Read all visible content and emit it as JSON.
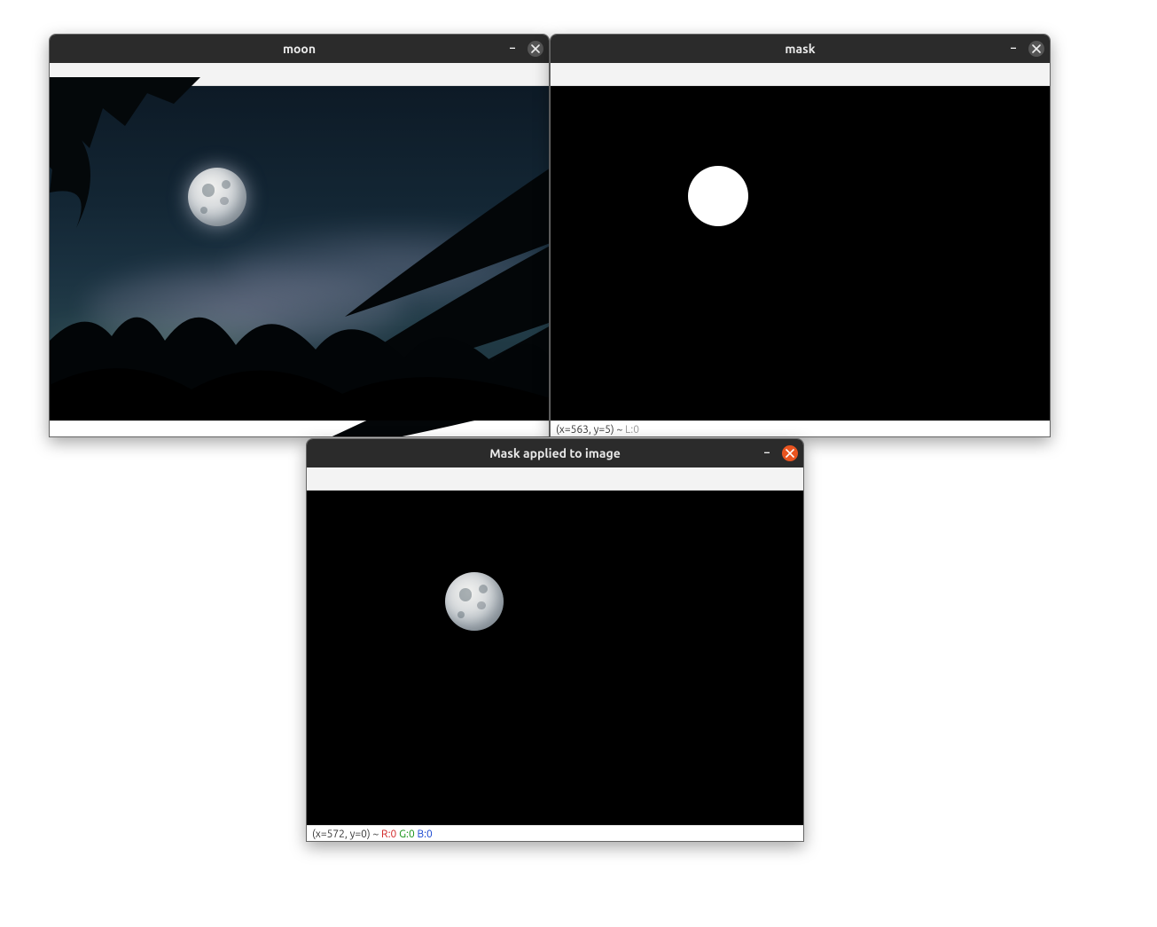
{
  "windows": {
    "moon": {
      "title": "moon",
      "has_status": false
    },
    "mask": {
      "title": "mask",
      "status_prefix": "(x=563, y=5) ~ ",
      "status_gray": "L:0"
    },
    "result": {
      "title": "Mask applied to image",
      "status_prefix": "(x=572, y=0) ~ ",
      "status_r": "R:0",
      "status_g": "G:0",
      "status_b": "B:0"
    }
  }
}
